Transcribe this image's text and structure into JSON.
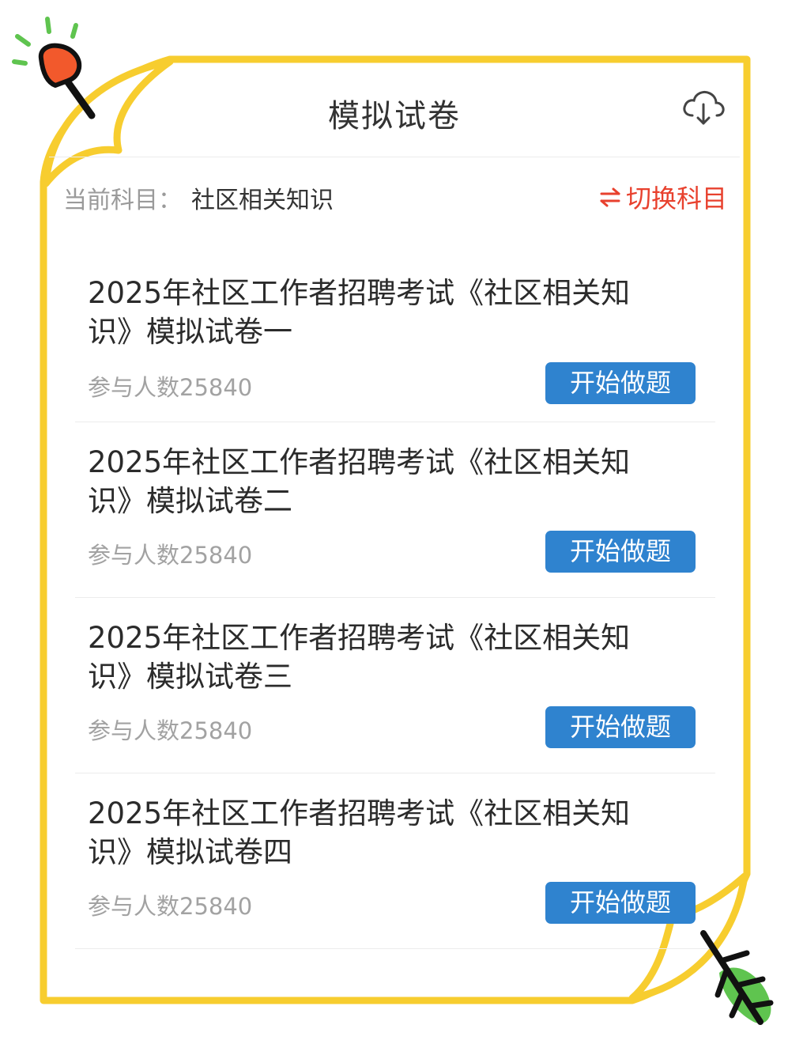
{
  "header": {
    "title": "模拟试卷",
    "download_icon": "cloud-download-icon"
  },
  "subject": {
    "label": "当前科目：",
    "value": "社区相关知识",
    "switch_label": "切换科目",
    "switch_icon": "swap-arrows-icon"
  },
  "exams": [
    {
      "title": "2025年社区工作者招聘考试《社区相关知识》模拟试卷一",
      "participants": "参与人数25840",
      "button": "开始做题"
    },
    {
      "title": "2025年社区工作者招聘考试《社区相关知识》模拟试卷二",
      "participants": "参与人数25840",
      "button": "开始做题"
    },
    {
      "title": "2025年社区工作者招聘考试《社区相关知识》模拟试卷三",
      "participants": "参与人数25840",
      "button": "开始做题"
    },
    {
      "title": "2025年社区工作者招聘考试《社区相关知识》模拟试卷四",
      "participants": "参与人数25840",
      "button": "开始做题"
    }
  ],
  "colors": {
    "frame": "#f7cd2f",
    "accent_red": "#e8412e",
    "button_blue": "#2f83cf",
    "pin_orange": "#f2592c",
    "leaf_green": "#5fc44f"
  }
}
